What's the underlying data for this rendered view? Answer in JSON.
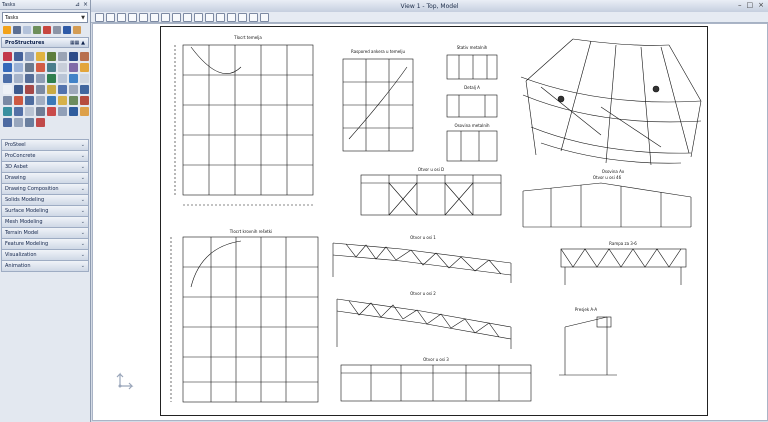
{
  "window_title": "View 1 - Top, Model",
  "panel": {
    "title": "Tasks",
    "combo_value": "Tasks",
    "section_title": "ProStructures",
    "categories": [
      "ProSteel",
      "ProConcrete",
      "3D Asbet",
      "Drawing",
      "Drawing Composition",
      "Solids Modeling",
      "Surface Modeling",
      "Mesh Modeling",
      "Terrain Model",
      "Feature Modeling",
      "Visualization",
      "Animation"
    ]
  },
  "drawing": {
    "titles": [
      "Tlocrt temelja",
      "Raspored ankera u temelju",
      "Stativ metalnih",
      "Detalj A",
      "Osovina metalnih",
      "Osovina Ax",
      "Otvor u osi D",
      "Otvor u osi 46",
      "Tlocrt krovnih rešetki",
      "Otvor u osi 1",
      "Rampa za 3-6",
      "Otvor u osi 2",
      "Presjek A-A",
      "Otvor u osi 3"
    ]
  },
  "colors": {
    "panel_bg": "#e3e8f0",
    "section_accent": "#0b1f4a",
    "canvas_bg": "#ffffff"
  }
}
